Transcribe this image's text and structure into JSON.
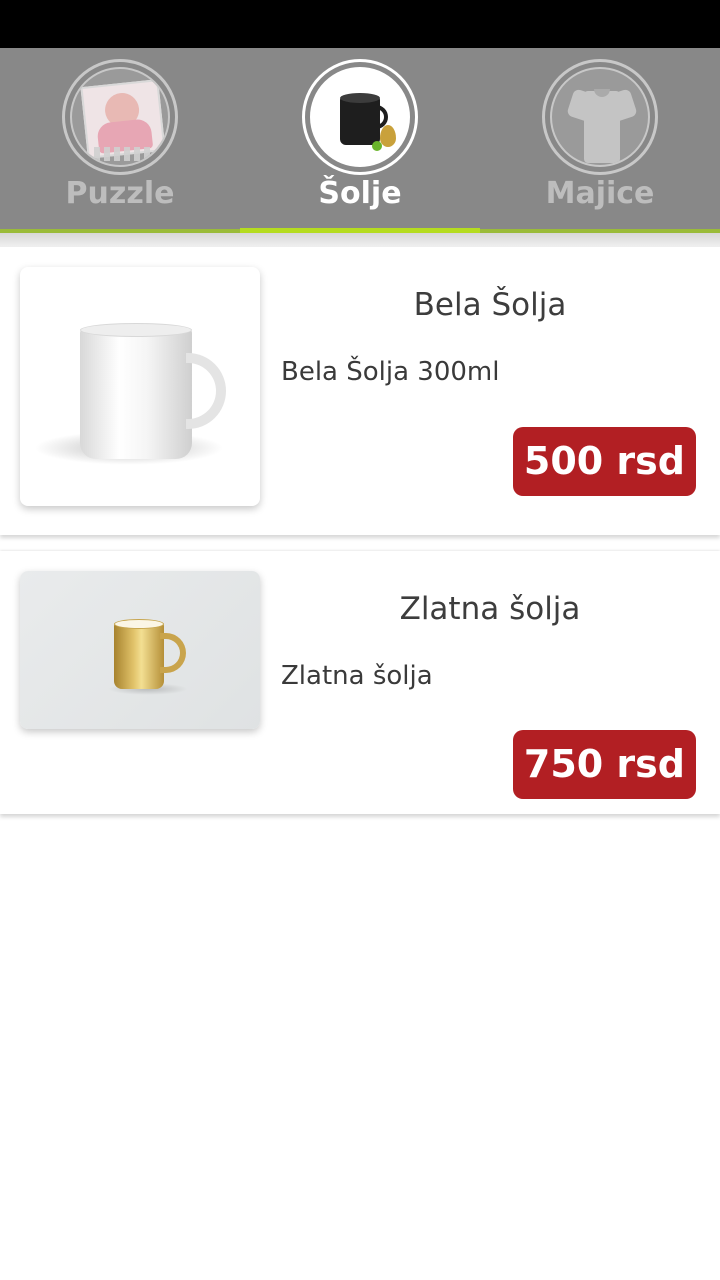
{
  "tabs": [
    {
      "label": "Puzzle",
      "icon": "puzzle-photo-icon",
      "active": false
    },
    {
      "label": "Šolje",
      "icon": "mug-icon",
      "active": true
    },
    {
      "label": "Majice",
      "icon": "tshirt-icon",
      "active": false
    }
  ],
  "products": [
    {
      "title": "Bela Šolja",
      "description": "Bela Šolja 300ml",
      "price": "500 rsd",
      "image": "white-mug-image"
    },
    {
      "title": "Zlatna šolja",
      "description": "Zlatna šolja",
      "price": "750 rsd",
      "image": "gold-mug-image"
    }
  ],
  "colors": {
    "tab_bar": "#888888",
    "active_indicator": "#b5dc1f",
    "price_badge": "#b21f23"
  }
}
